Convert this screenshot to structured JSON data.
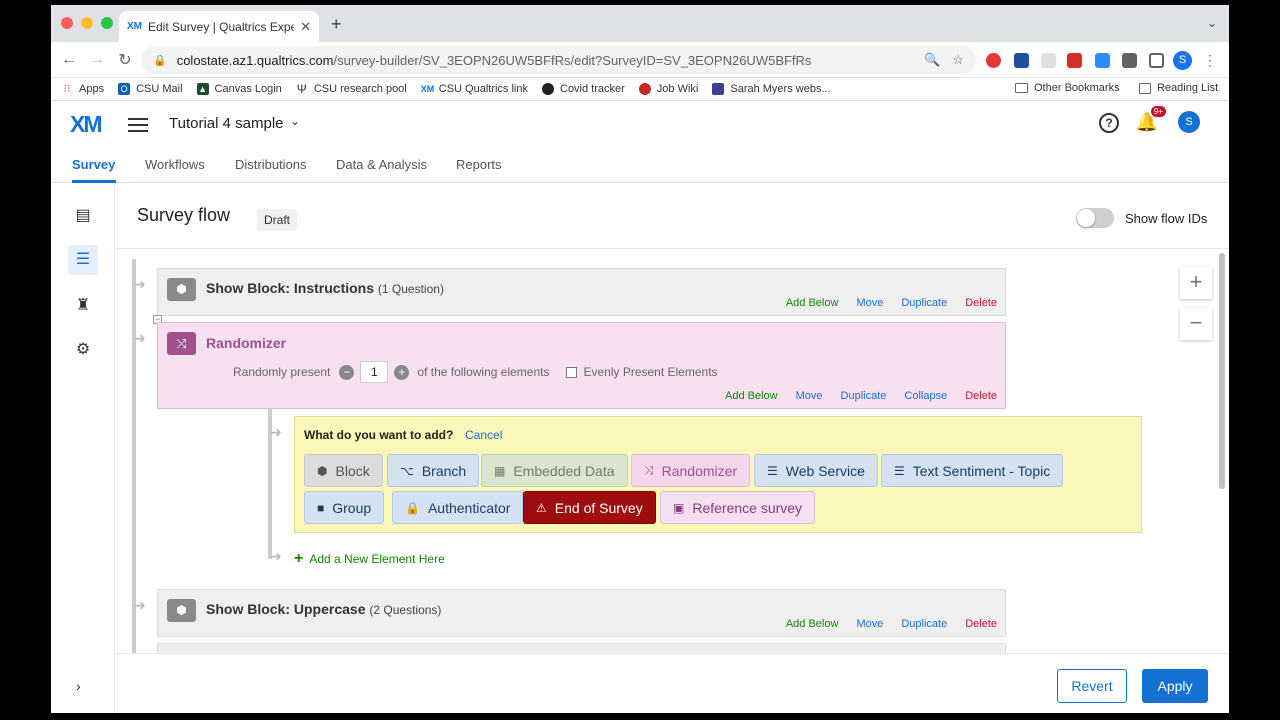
{
  "browser": {
    "tab_title": "Edit Survey | Qualtrics Experie",
    "tab_favicon": "XM",
    "new_tab": "+",
    "url_host": "colostate.az1.qualtrics.com",
    "url_path": "/survey-builder/SV_3EOPN26UW5BFfRs/edit?SurveyID=SV_3EOPN26UW5BFfRs",
    "profile_initial": "S",
    "bookmarks": [
      "Apps",
      "CSU Mail",
      "Canvas Login",
      "CSU research pool",
      "CSU Qualtrics link",
      "Covid tracker",
      "Job Wiki",
      "Sarah Myers webs..."
    ],
    "other_bookmarks": "Other Bookmarks",
    "reading_list": "Reading List"
  },
  "header": {
    "logo": "XM",
    "project_name": "Tutorial 4 sample",
    "notif_badge": "9+",
    "avatar_initial": "S"
  },
  "nav_tabs": [
    "Survey",
    "Workflows",
    "Distributions",
    "Data & Analysis",
    "Reports"
  ],
  "flow": {
    "title": "Survey flow",
    "status": "Draft",
    "show_flow_ids_label": "Show flow IDs",
    "blocks": [
      {
        "label": "Show Block: Instructions",
        "count": "(1 Question)"
      },
      {
        "label": "Show Block: Uppercase",
        "count": "(2 Questions)"
      }
    ],
    "actions": {
      "add_below": "Add Below",
      "move": "Move",
      "duplicate": "Duplicate",
      "collapse": "Collapse",
      "delete": "Delete"
    },
    "randomizer": {
      "title": "Randomizer",
      "prefix": "Randomly present",
      "value": "1",
      "suffix": "of the following elements",
      "evenly": "Evenly Present Elements"
    },
    "add_panel": {
      "question": "What do you want to add?",
      "cancel": "Cancel",
      "elements": [
        "Block",
        "Branch",
        "Embedded Data",
        "Randomizer",
        "Web Service",
        "Text Sentiment - Topic",
        "Group",
        "Authenticator",
        "End of Survey",
        "Reference survey"
      ]
    },
    "add_new": "Add a New Element Here"
  },
  "footer": {
    "revert": "Revert",
    "apply": "Apply"
  },
  "colors": {
    "brand": "#1471d3",
    "add": "#138700",
    "delete": "#c8102e",
    "randomizer": "#a0508c",
    "end_of_survey": "#9e0e0e"
  }
}
